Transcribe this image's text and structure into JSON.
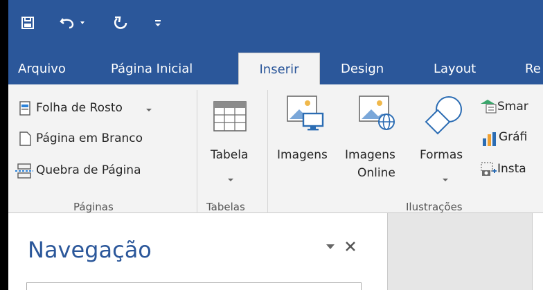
{
  "qat": {
    "save_icon": "save-icon",
    "undo_icon": "undo-icon",
    "undo_dropdown_icon": "chevron-down-icon",
    "redo_icon": "repeat-icon",
    "customize_icon": "customize-qat-icon"
  },
  "tabs": [
    {
      "label": "Arquivo"
    },
    {
      "label": "Página Inicial"
    },
    {
      "label": "Inserir"
    },
    {
      "label": "Design"
    },
    {
      "label": "Layout"
    },
    {
      "label": "Re"
    }
  ],
  "ribbon": {
    "paginas": {
      "items": [
        "Folha de Rosto",
        "Página em Branco",
        "Quebra de Página"
      ],
      "label": "Páginas"
    },
    "tabelas": {
      "button": "Tabela",
      "label": "Tabelas"
    },
    "ilustracoes": {
      "imagens": "Imagens",
      "imagens_online_1": "Imagens",
      "imagens_online_2": "Online",
      "formas": "Formas",
      "smartart": "Smar",
      "grafico": "Gráfi",
      "instantaneo": "Insta",
      "label": "Ilustrações"
    }
  },
  "nav": {
    "title": "Navegação"
  },
  "colors": {
    "accent": "#2b579a",
    "ribbon_bg": "#f3f3f3"
  }
}
